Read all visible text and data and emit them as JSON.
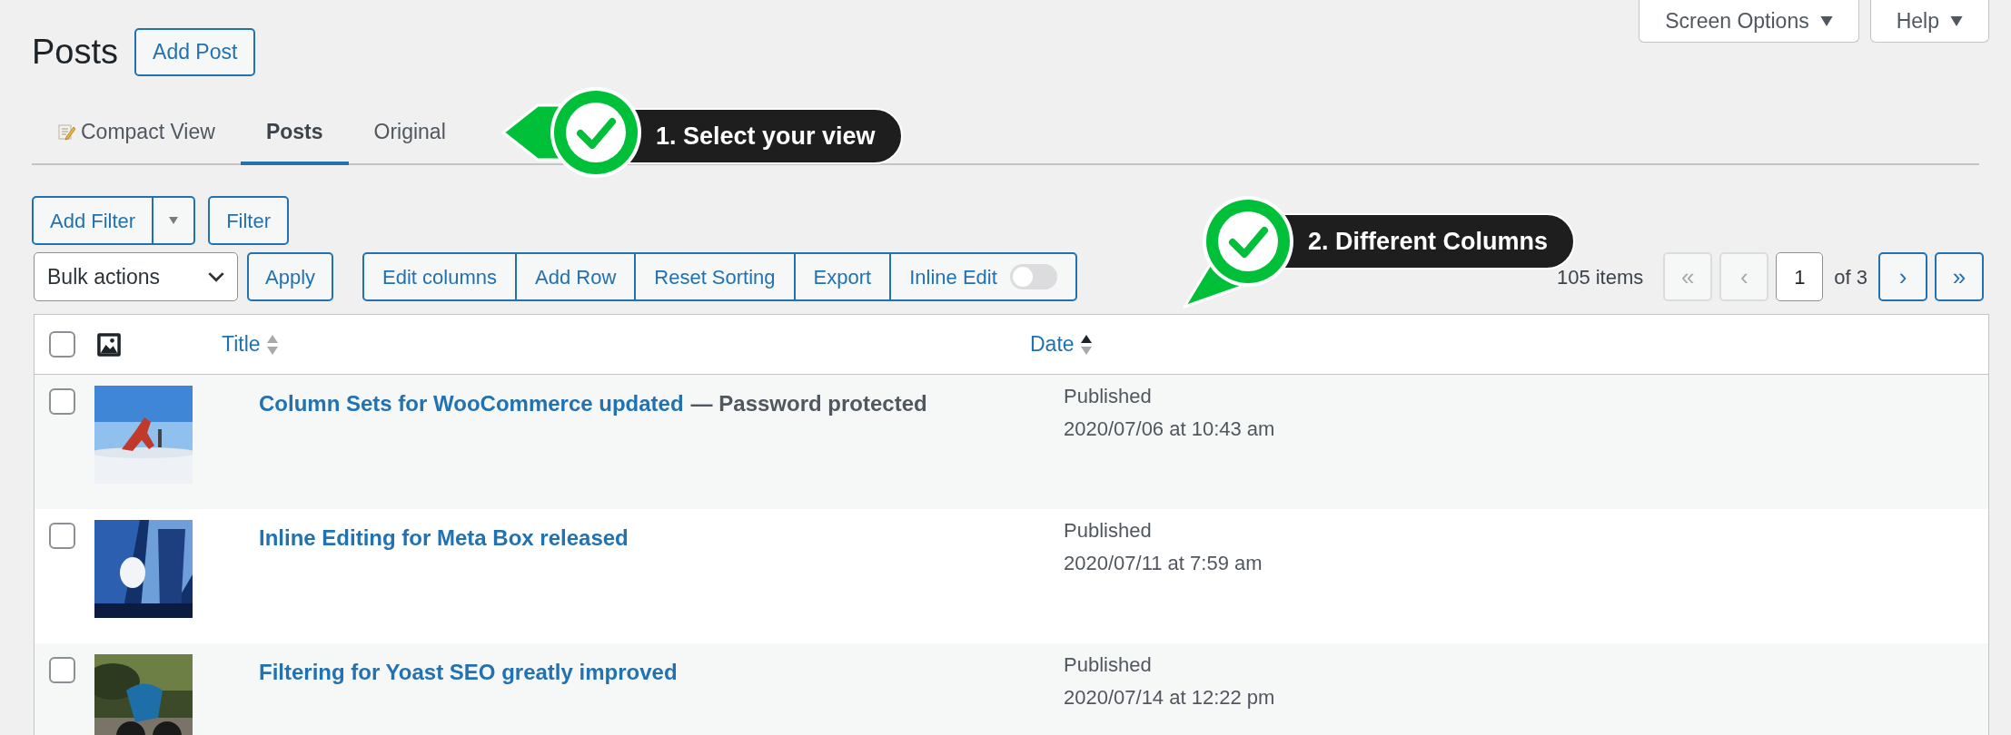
{
  "page": {
    "title": "Posts",
    "add_button": "Add Post"
  },
  "header_buttons": [
    {
      "label": "Screen Options"
    },
    {
      "label": "Help"
    }
  ],
  "tabs": [
    {
      "label": "Compact View",
      "selected": false,
      "kind": "memo"
    },
    {
      "label": "Posts",
      "selected": true,
      "kind": "plain"
    },
    {
      "label": "Original",
      "selected": false,
      "kind": "plain"
    }
  ],
  "filters": {
    "add_filter": "Add Filter",
    "filter": "Filter"
  },
  "bulk": {
    "value": "Bulk actions",
    "apply": "Apply"
  },
  "toolbar": [
    {
      "label": "Edit columns",
      "kind": "button"
    },
    {
      "label": "Add Row",
      "kind": "button"
    },
    {
      "label": "Reset Sorting",
      "kind": "button"
    },
    {
      "label": "Export",
      "kind": "button"
    },
    {
      "label": "Inline Edit",
      "kind": "toggle",
      "on": false
    }
  ],
  "pagination": {
    "count": "105 items",
    "page": "1",
    "of": "of 3",
    "buttons": [
      {
        "label": "«",
        "disabled": true
      },
      {
        "label": "‹",
        "disabled": true
      },
      {
        "label": "›",
        "disabled": false
      },
      {
        "label": "»",
        "disabled": false
      }
    ]
  },
  "callouts": [
    {
      "text": "1. Select your view",
      "kind": "left"
    },
    {
      "text": "2. Different Columns",
      "kind": "down"
    }
  ],
  "table": {
    "all_checked": false,
    "columns": [
      {
        "label": "Title",
        "sorted": false
      },
      {
        "label": "Date",
        "sorted": true
      }
    ],
    "rows": [
      {
        "checked": false,
        "title": "Column Sets for WooCommerce updated",
        "suffix": "— Password protected",
        "status": "Published",
        "date": "2020/07/06 at 10:43 am",
        "kind": "picture"
      },
      {
        "checked": false,
        "title": "Inline Editing for Meta Box released",
        "status": "Published",
        "date": "2020/07/11 at 7:59 am",
        "kind": "picture"
      },
      {
        "checked": false,
        "title": "Filtering for Yoast SEO greatly improved",
        "status": "Published",
        "date": "2020/07/14 at 12:22 pm",
        "kind": "picture"
      }
    ]
  }
}
